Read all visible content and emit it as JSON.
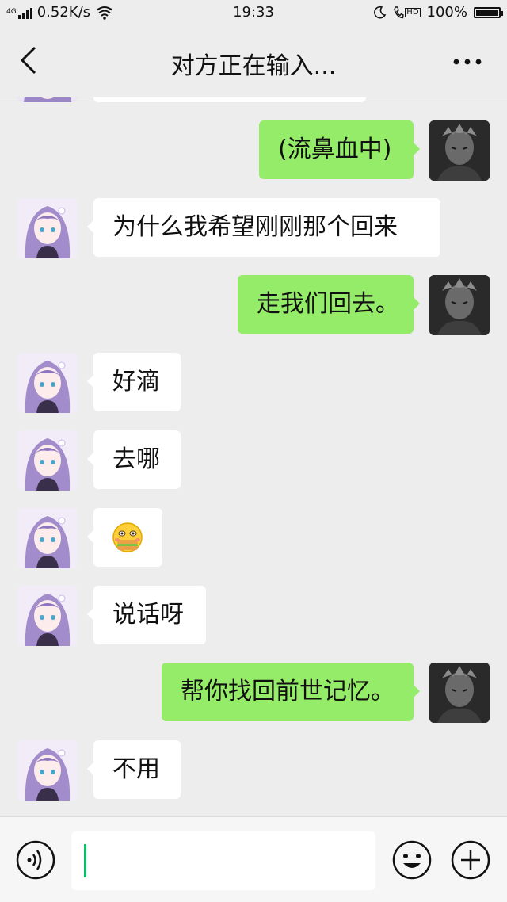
{
  "status_bar": {
    "network_type": "4G",
    "speed": "0.52K/s",
    "time": "19:33",
    "hd_label": "HD",
    "battery": "100%",
    "battery_level": 1.0
  },
  "header": {
    "title": "对方正在输入..."
  },
  "messages": [
    {
      "side": "right",
      "text": "(流鼻血中)"
    },
    {
      "side": "left",
      "text": "为什么我希望刚刚那个回来"
    },
    {
      "side": "right",
      "text": "走我们回去。"
    },
    {
      "side": "left",
      "text": "好滴"
    },
    {
      "side": "left",
      "text": "去哪"
    },
    {
      "side": "left",
      "type": "emoji",
      "emoji": "😋"
    },
    {
      "side": "left",
      "text": "说话呀"
    },
    {
      "side": "right",
      "text": "帮你找回前世记忆。"
    },
    {
      "side": "left",
      "text": "不用"
    }
  ],
  "colors": {
    "background": "#ededed",
    "outgoing_bubble": "#95ec69",
    "incoming_bubble": "#ffffff",
    "caret": "#07c160"
  },
  "icons": {
    "back": "chevron-left-icon",
    "more": "more-dots-icon",
    "voice": "voice-icon",
    "emoji": "emoji-face-icon",
    "plus": "plus-icon"
  }
}
